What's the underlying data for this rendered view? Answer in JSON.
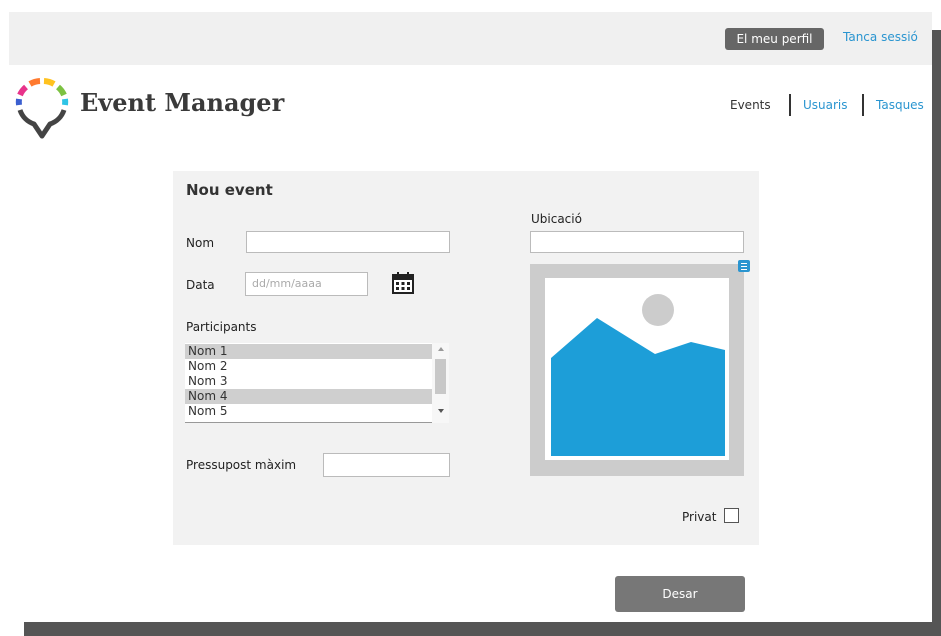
{
  "header": {
    "profile_button": "El meu perfil",
    "logout_link": "Tanca sessió"
  },
  "brand": {
    "name": "Event Manager"
  },
  "nav": {
    "events": "Events",
    "users": "Usuaris",
    "tasks": "Tasques"
  },
  "form": {
    "title": "Nou event",
    "name_label": "Nom",
    "name_value": "",
    "date_label": "Data",
    "date_placeholder": "dd/mm/aaaa",
    "participants_label": "Participants",
    "participants": [
      {
        "label": "Nom 1",
        "selected": true
      },
      {
        "label": "Nom 2",
        "selected": false
      },
      {
        "label": "Nom 3",
        "selected": false
      },
      {
        "label": "Nom 4",
        "selected": true
      },
      {
        "label": "Nom 5",
        "selected": false
      }
    ],
    "budget_label": "Pressupost màxim",
    "budget_value": "",
    "location_label": "Ubicació",
    "location_value": "",
    "private_label": "Privat",
    "private_checked": false,
    "save_button": "Desar"
  },
  "icons": {
    "logo": "event-manager-logo",
    "calendar": "calendar-icon",
    "image_placeholder": "image-placeholder-icon",
    "menu": "menu-icon"
  },
  "colors": {
    "accent": "#2a95d0",
    "button_dark": "#666666",
    "save_button": "#777777",
    "panel_bg": "#f2f2f2",
    "image_blue": "#1d9ed8"
  }
}
